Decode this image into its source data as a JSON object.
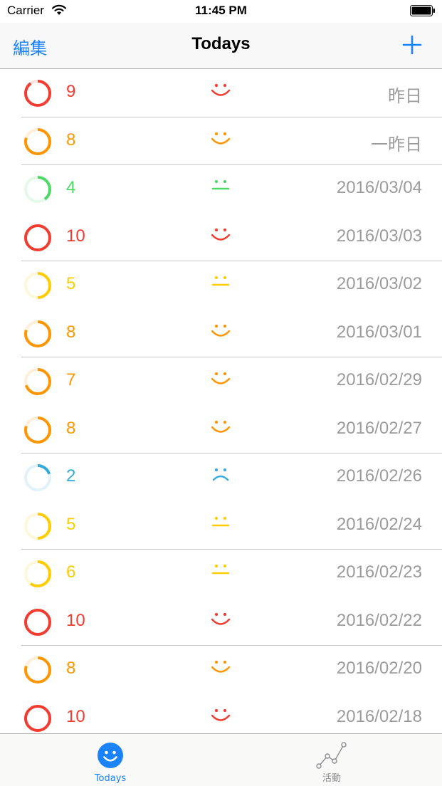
{
  "status_bar": {
    "carrier": "Carrier",
    "time": "11:45 PM"
  },
  "nav": {
    "edit_label": "編集",
    "title": "Todays",
    "add_icon": "plus-icon"
  },
  "colors": {
    "accent": "#1a82fb",
    "level_red": "#f33b2f",
    "level_orange": "#ff9500",
    "level_yellow": "#ffcc00",
    "level_green": "#4cd964",
    "level_blue": "#34aadc",
    "date_gray": "#9b9b9b"
  },
  "entries": [
    {
      "score": "9",
      "date": "昨日",
      "mood": "happy",
      "level": 0.9,
      "color": "#f33b2f"
    },
    {
      "score": "8",
      "date": "一昨日",
      "mood": "happy",
      "level": 0.8,
      "color": "#ff9500"
    },
    {
      "score": "4",
      "date": "2016/03/04",
      "mood": "neutral",
      "level": 0.4,
      "color": "#4cd964"
    },
    {
      "score": "10",
      "date": "2016/03/03",
      "mood": "happy",
      "level": 1.0,
      "color": "#f33b2f"
    },
    {
      "score": "5",
      "date": "2016/03/02",
      "mood": "neutral",
      "level": 0.5,
      "color": "#ffcc00"
    },
    {
      "score": "8",
      "date": "2016/03/01",
      "mood": "happy",
      "level": 0.8,
      "color": "#ff9500"
    },
    {
      "score": "7",
      "date": "2016/02/29",
      "mood": "happy",
      "level": 0.7,
      "color": "#ff9500"
    },
    {
      "score": "8",
      "date": "2016/02/27",
      "mood": "happy",
      "level": 0.8,
      "color": "#ff9500"
    },
    {
      "score": "2",
      "date": "2016/02/26",
      "mood": "sad",
      "level": 0.2,
      "color": "#34aadc"
    },
    {
      "score": "5",
      "date": "2016/02/24",
      "mood": "neutral",
      "level": 0.5,
      "color": "#ffcc00"
    },
    {
      "score": "6",
      "date": "2016/02/23",
      "mood": "neutral",
      "level": 0.6,
      "color": "#ffcc00"
    },
    {
      "score": "10",
      "date": "2016/02/22",
      "mood": "happy",
      "level": 1.0,
      "color": "#f33b2f"
    },
    {
      "score": "8",
      "date": "2016/02/20",
      "mood": "happy",
      "level": 0.8,
      "color": "#ff9500"
    },
    {
      "score": "10",
      "date": "2016/02/18",
      "mood": "happy",
      "level": 1.0,
      "color": "#f33b2f"
    }
  ],
  "tab_bar": {
    "tabs": [
      {
        "label": "Todays",
        "icon": "smiley-icon",
        "selected": true
      },
      {
        "label": "活動",
        "icon": "line-chart-icon",
        "selected": false
      }
    ]
  }
}
